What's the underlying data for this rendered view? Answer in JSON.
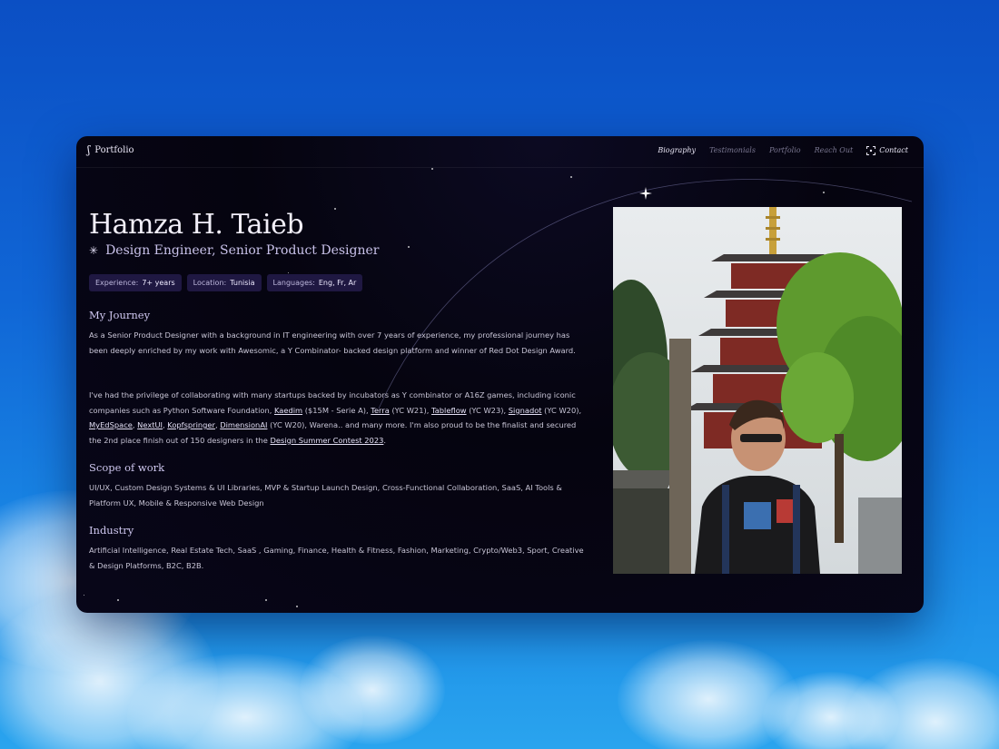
{
  "nav": {
    "brand": "Portfolio",
    "links": [
      "Biography",
      "Testimonials",
      "Portfolio",
      "Reach Out"
    ],
    "contact": "Contact"
  },
  "hero": {
    "name": "Hamza H. Taieb",
    "role": "Design Engineer, Senior Product Designer"
  },
  "chips": [
    {
      "label": "Experience:",
      "value": "7+ years"
    },
    {
      "label": "Location:",
      "value": "Tunisia"
    },
    {
      "label": "Languages:",
      "value": "Eng, Fr, Ar"
    }
  ],
  "journey": {
    "title": "My Journey",
    "p1": "As a Senior Product Designer with a background in IT engineering with over 7 years of experience, my professional journey has been deeply enriched by my work with Awesomic, a Y Combinator- backed design platform and winner of Red Dot Design Award.",
    "p2_start": "I've had the privilege of collaborating with many startups backed by incubators as Y combinator or A16Z games, including iconic companies such as Python Software Foundation, ",
    "links": {
      "kaedim": "Kaedim",
      "terra": "Terra",
      "tableflow": "Tableflow",
      "signadot": "Signadot",
      "myedspace": "MyEdSpace",
      "nextui": "NextUI",
      "kopfspringer": "Kopfspringer",
      "dimensionai": "DimensionAI",
      "contest": "Design Summer Contest 2023"
    },
    "kaedim_note": " ($15M - Serie A), ",
    "terra_note": " (YC W21), ",
    "tableflow_note": " (YC W23), ",
    "signadot_note": " (YC W20), ",
    "sep": ", ",
    "dimensionai_note": " (YC W20), Warena.. and many more. I'm also proud to be the finalist and secured the 2nd place finish out of 150 designers in the ",
    "end": "."
  },
  "scope": {
    "title": "Scope of work",
    "text": "UI/UX, Custom Design Systems & UI Libraries, MVP & Startup Launch Design, Cross-Functional Collaboration, SaaS, AI Tools & Platform UX, Mobile & Responsive Web Design"
  },
  "industry": {
    "title": "Industry",
    "text": "Artificial Intelligence, Real Estate Tech, SaaS , Gaming, Finance, Health & Fitness, Fashion, Marketing, Crypto/Web3, Sport, Creative & Design Platforms, B2C, B2B."
  },
  "icons": {
    "brand": "logo-mark-icon",
    "role": "asterisk-icon",
    "contact": "scan-frame-icon"
  },
  "colors": {
    "window_bg": "#05040f",
    "chip_bg": "#1f1842",
    "sky_top": "#0b4fc4",
    "sky_bottom": "#2aa4ee"
  }
}
